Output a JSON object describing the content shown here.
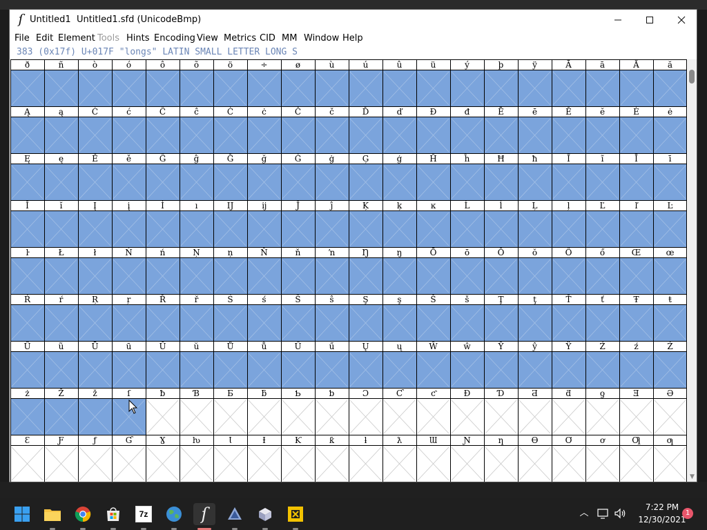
{
  "window": {
    "title": "Untitled1  Untitled1.sfd (UnicodeBmp)",
    "minimize_icon": "minimize-icon",
    "maximize_icon": "maximize-icon",
    "close_icon": "close-icon"
  },
  "menubar": {
    "items": [
      {
        "label": "File",
        "enabled": true
      },
      {
        "label": "Edit",
        "enabled": true
      },
      {
        "label": "Element",
        "enabled": true
      },
      {
        "label": "Tools",
        "enabled": false
      },
      {
        "label": "Hints",
        "enabled": true
      },
      {
        "label": "Encoding",
        "enabled": true
      },
      {
        "label": "View",
        "enabled": true
      },
      {
        "label": "Metrics",
        "enabled": true
      },
      {
        "label": "CID",
        "enabled": true
      },
      {
        "label": "MM",
        "enabled": true
      },
      {
        "label": "Window",
        "enabled": true
      },
      {
        "label": "Help",
        "enabled": true
      }
    ]
  },
  "glyph_info": "383 (0x17f) U+017F \"longs\" LATIN SMALL LETTER LONG S",
  "glyph_grid": {
    "rows": [
      {
        "labels": [
          "ð",
          "ñ",
          "ò",
          "ó",
          "ô",
          "õ",
          "ö",
          "÷",
          "ø",
          "ù",
          "ú",
          "û",
          "ü",
          "ý",
          "þ",
          "ÿ",
          "Ā",
          "ā",
          "Ă",
          "ă"
        ],
        "selected_count": 20
      },
      {
        "labels": [
          "Ą",
          "ą",
          "Ć",
          "ć",
          "Ĉ",
          "ĉ",
          "Ċ",
          "ċ",
          "Č",
          "č",
          "Ď",
          "ď",
          "Đ",
          "đ",
          "Ē",
          "ē",
          "Ĕ",
          "ĕ",
          "Ė",
          "ė"
        ],
        "selected_count": 20
      },
      {
        "labels": [
          "Ę",
          "ę",
          "Ě",
          "ě",
          "Ĝ",
          "ĝ",
          "Ğ",
          "ğ",
          "Ġ",
          "ġ",
          "Ģ",
          "ģ",
          "Ĥ",
          "ĥ",
          "Ħ",
          "ħ",
          "Ĩ",
          "ĩ",
          "Ī",
          "ī"
        ],
        "selected_count": 20
      },
      {
        "labels": [
          "Ĭ",
          "ĭ",
          "Į",
          "į",
          "İ",
          "ı",
          "Ĳ",
          "ĳ",
          "Ĵ",
          "ĵ",
          "Ķ",
          "ķ",
          "ĸ",
          "Ĺ",
          "ĺ",
          "Ļ",
          "ļ",
          "Ľ",
          "ľ",
          "Ŀ"
        ],
        "selected_count": 20
      },
      {
        "labels": [
          "ŀ",
          "Ł",
          "ł",
          "Ń",
          "ń",
          "Ņ",
          "ņ",
          "Ň",
          "ň",
          "ŉ",
          "Ŋ",
          "ŋ",
          "Ō",
          "ō",
          "Ŏ",
          "ŏ",
          "Ő",
          "ő",
          "Œ",
          "œ"
        ],
        "selected_count": 20
      },
      {
        "labels": [
          "Ŕ",
          "ŕ",
          "Ŗ",
          "ŗ",
          "Ř",
          "ř",
          "Ś",
          "ś",
          "Ŝ",
          "ŝ",
          "Ş",
          "ş",
          "Š",
          "š",
          "Ţ",
          "ţ",
          "Ť",
          "ť",
          "Ŧ",
          "ŧ"
        ],
        "selected_count": 20
      },
      {
        "labels": [
          "Ũ",
          "ũ",
          "Ū",
          "ū",
          "Ŭ",
          "ŭ",
          "Ů",
          "ů",
          "Ű",
          "ű",
          "Ų",
          "ų",
          "Ŵ",
          "ŵ",
          "Ŷ",
          "ŷ",
          "Ÿ",
          "Ź",
          "ź",
          "Ż"
        ],
        "selected_count": 20
      },
      {
        "labels": [
          "ż",
          "Ž",
          "ž",
          "ſ",
          "ƀ",
          "Ɓ",
          "Ƃ",
          "ƃ",
          "Ƅ",
          "ƅ",
          "Ɔ",
          "Ƈ",
          "ƈ",
          "Ɖ",
          "Ɗ",
          "Ƌ",
          "ƌ",
          "ƍ",
          "Ǝ",
          "Ə"
        ],
        "selected_count": 4
      },
      {
        "labels": [
          "Ɛ",
          "Ƒ",
          "ƒ",
          "Ɠ",
          "Ɣ",
          "ƕ",
          "Ɩ",
          "Ɨ",
          "Ƙ",
          "ƙ",
          "ƚ",
          "ƛ",
          "Ɯ",
          "Ɲ",
          "ƞ",
          "Ɵ",
          "Ơ",
          "ơ",
          "Ƣ",
          "ƣ"
        ],
        "selected_count": 0
      }
    ]
  },
  "colors": {
    "selected_cell": "#7ba4dc",
    "empty_cell": "#ffffff",
    "cell_cross": "#c8c8c8",
    "selected_cross": "#a4c0e6",
    "info_text": "#6b86b6"
  },
  "taskbar": {
    "apps": [
      {
        "name": "start-button",
        "icon": "windows-logo-icon",
        "indicator": false,
        "active": false
      },
      {
        "name": "file-explorer-button",
        "icon": "folder-icon",
        "indicator": true,
        "active": false
      },
      {
        "name": "chrome-button",
        "icon": "chrome-icon",
        "indicator": true,
        "active": false
      },
      {
        "name": "store-button",
        "icon": "store-icon",
        "indicator": true,
        "active": false
      },
      {
        "name": "7zip-button",
        "icon": "7zip-icon",
        "text": "7z",
        "indicator": true,
        "active": false
      },
      {
        "name": "globe-app-button",
        "icon": "globe-icon",
        "indicator": true,
        "active": false
      },
      {
        "name": "fontforge-button",
        "icon": "fontforge-icon",
        "indicator": true,
        "active": true
      },
      {
        "name": "inkscape-button",
        "icon": "inkscape-icon",
        "indicator": true,
        "active": false
      },
      {
        "name": "cube-app-button",
        "icon": "cube-icon",
        "indicator": true,
        "active": false
      },
      {
        "name": "yellow-app-button",
        "icon": "yellow-frame-icon",
        "indicator": true,
        "active": false
      }
    ],
    "tray": {
      "chevron_icon": "chevron-up-icon",
      "network_icon": "network-icon",
      "volume_icon": "volume-icon",
      "time": "7:22 PM",
      "date": "12/30/2021",
      "notification_count": "1"
    }
  }
}
